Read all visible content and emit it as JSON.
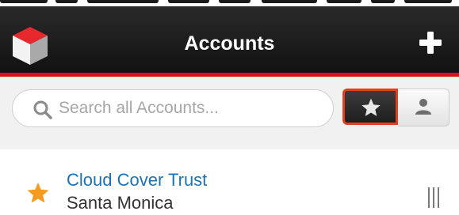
{
  "header": {
    "title": "Accounts",
    "background_color": "#1a1a1a",
    "accent_color": "#d8121b",
    "logo_icon": "cube-logo-icon",
    "add_icon": "plus-icon"
  },
  "search": {
    "placeholder": "Search all Accounts...",
    "value": "",
    "icon": "search-icon"
  },
  "filters": {
    "favorites_icon": "star-icon",
    "favorites_active": true,
    "highlight_color": "#e0401e",
    "my_items_icon": "user-icon"
  },
  "accounts": [
    {
      "name": "Cloud Cover Trust",
      "city": "Santa Monica",
      "favorite": true,
      "star_color": "#f39c1f",
      "name_color": "#1a72b8"
    }
  ]
}
